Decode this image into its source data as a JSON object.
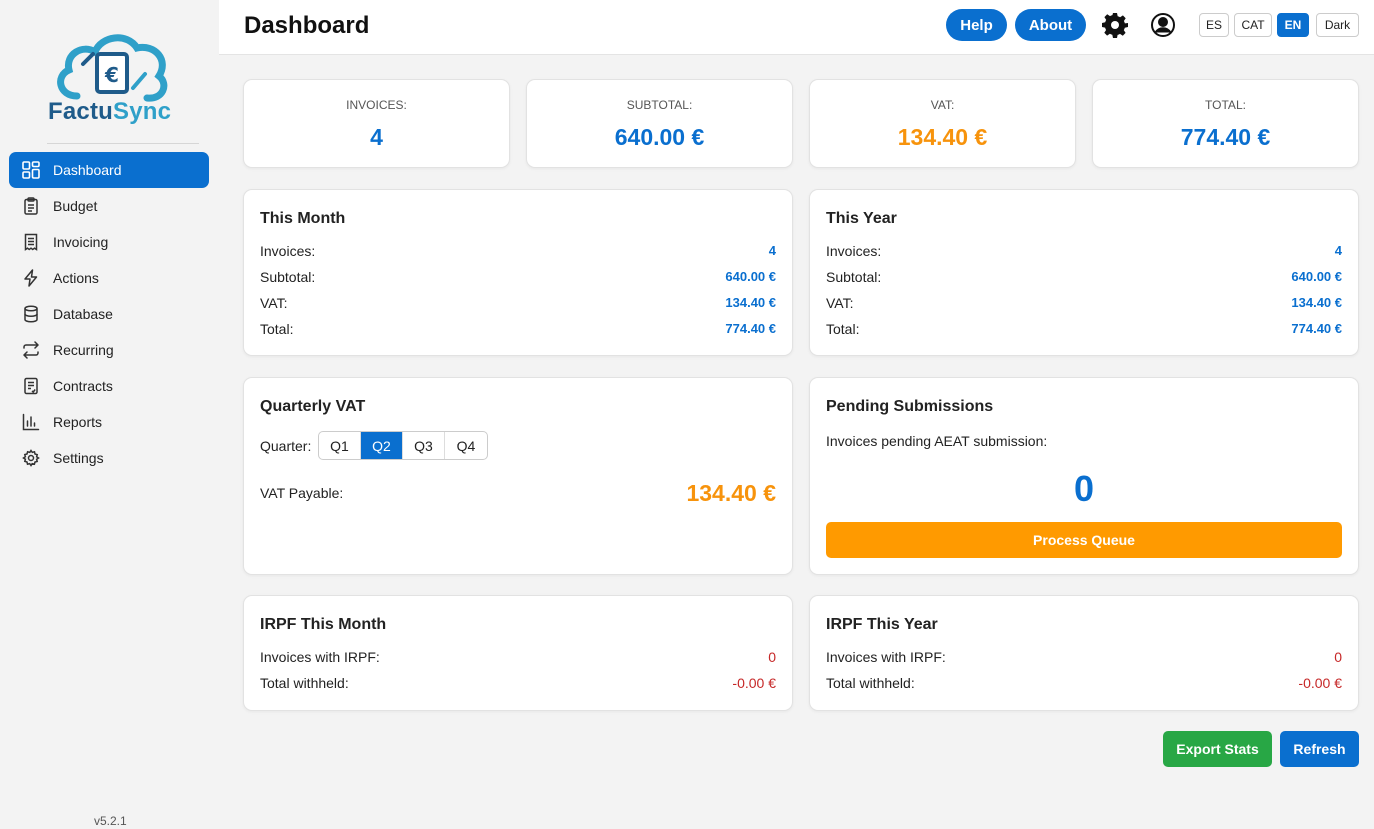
{
  "brand": {
    "name_part1": "Factu",
    "name_part2": "Sync",
    "version": "v5.2.1"
  },
  "sidebar": {
    "items": [
      {
        "label": "Dashboard",
        "icon": "dashboard-icon",
        "active": true
      },
      {
        "label": "Budget",
        "icon": "clipboard-icon"
      },
      {
        "label": "Invoicing",
        "icon": "receipt-icon"
      },
      {
        "label": "Actions",
        "icon": "lightning-icon"
      },
      {
        "label": "Database",
        "icon": "database-icon"
      },
      {
        "label": "Recurring",
        "icon": "repeat-icon"
      },
      {
        "label": "Contracts",
        "icon": "contract-icon"
      },
      {
        "label": "Reports",
        "icon": "bar-chart-icon"
      },
      {
        "label": "Settings",
        "icon": "gear-icon"
      }
    ]
  },
  "header": {
    "title": "Dashboard",
    "help_label": "Help",
    "about_label": "About",
    "languages": [
      {
        "label": "ES"
      },
      {
        "label": "CAT"
      },
      {
        "label": "EN",
        "active": true
      }
    ],
    "dark_label": "Dark"
  },
  "stats": {
    "invoices": {
      "label": "INVOICES:",
      "value": "4"
    },
    "subtotal": {
      "label": "SUBTOTAL:",
      "value": "640.00 €"
    },
    "vat": {
      "label": "VAT:",
      "value": "134.40 €"
    },
    "total": {
      "label": "TOTAL:",
      "value": "774.40 €"
    }
  },
  "this_month": {
    "title": "This Month",
    "rows": [
      {
        "label": "Invoices:",
        "value": "4"
      },
      {
        "label": "Subtotal:",
        "value": "640.00 €"
      },
      {
        "label": "VAT:",
        "value": "134.40 €"
      },
      {
        "label": "Total:",
        "value": "774.40 €"
      }
    ]
  },
  "this_year": {
    "title": "This Year",
    "rows": [
      {
        "label": "Invoices:",
        "value": "4"
      },
      {
        "label": "Subtotal:",
        "value": "640.00 €"
      },
      {
        "label": "VAT:",
        "value": "134.40 €"
      },
      {
        "label": "Total:",
        "value": "774.40 €"
      }
    ]
  },
  "quarterly_vat": {
    "title": "Quarterly VAT",
    "quarter_label": "Quarter:",
    "quarters": [
      "Q1",
      "Q2",
      "Q3",
      "Q4"
    ],
    "selected": "Q2",
    "payable_label": "VAT Payable:",
    "payable_value": "134.40 €"
  },
  "pending": {
    "title": "Pending Submissions",
    "text": "Invoices pending AEAT submission:",
    "count": "0",
    "button_label": "Process Queue"
  },
  "irpf_month": {
    "title": "IRPF This Month",
    "rows": [
      {
        "label": "Invoices with IRPF:",
        "value": "0"
      },
      {
        "label": "Total withheld:",
        "value": "-0.00 €"
      }
    ]
  },
  "irpf_year": {
    "title": "IRPF This Year",
    "rows": [
      {
        "label": "Invoices with IRPF:",
        "value": "0"
      },
      {
        "label": "Total withheld:",
        "value": "-0.00 €"
      }
    ]
  },
  "actions": {
    "export_label": "Export Stats",
    "refresh_label": "Refresh"
  },
  "colors": {
    "accent": "#0a6fcf",
    "orange": "#f7930c",
    "green": "#28a745",
    "red": "#c62828"
  }
}
